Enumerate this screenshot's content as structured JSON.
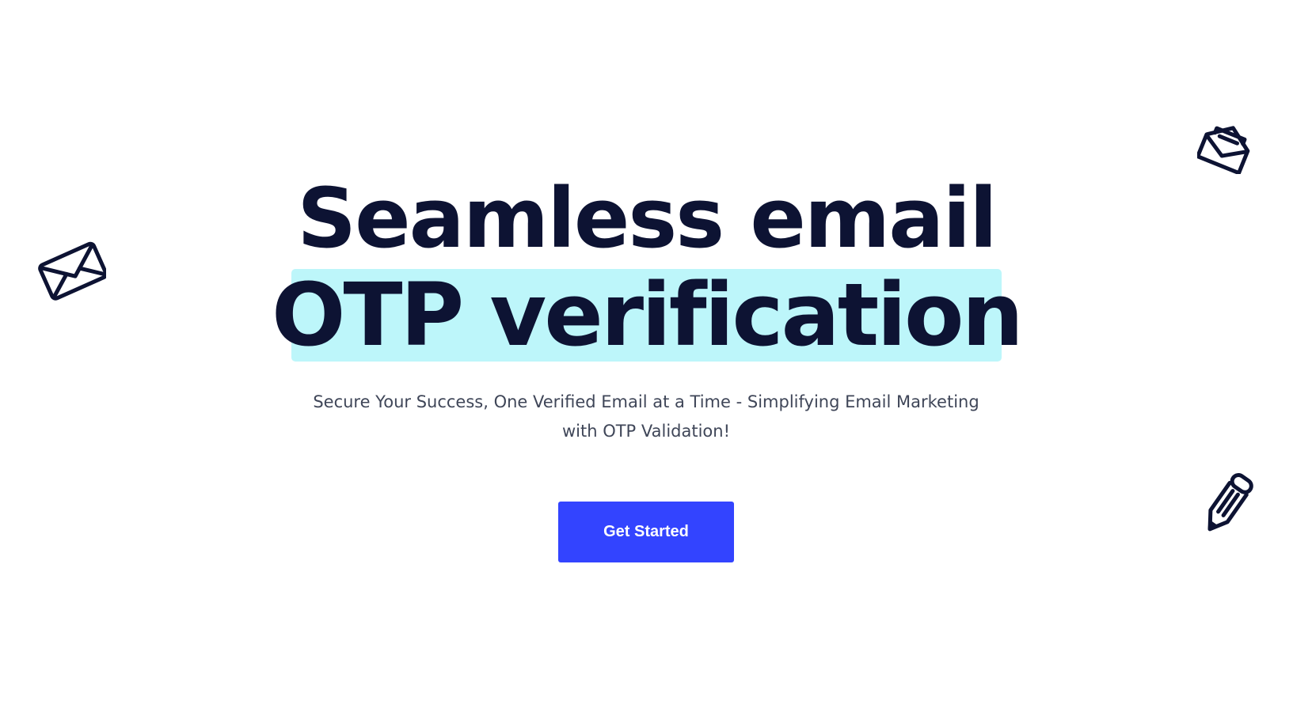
{
  "hero": {
    "headline_line1": "Seamless email",
    "headline_line2": "OTP verification",
    "subtitle_line1": "Secure Your Success, One Verified Email at a Time - Simplifying Email Marketing",
    "subtitle_line2": "with OTP Validation!",
    "cta_label": "Get Started"
  },
  "colors": {
    "heading": "#0d1333",
    "highlight": "#bdf6fa",
    "subtitle": "#3f4658",
    "cta_background": "#3344ff",
    "cta_text": "#ffffff"
  },
  "icons": [
    "envelope-icon",
    "open-envelope-icon",
    "pencil-icon"
  ]
}
